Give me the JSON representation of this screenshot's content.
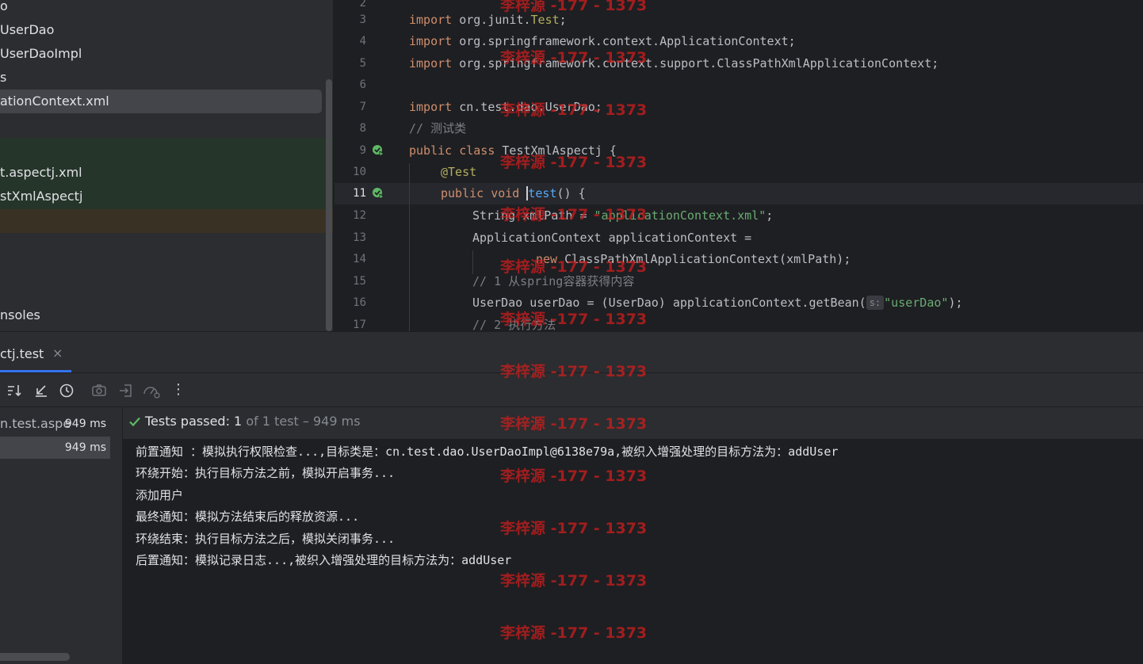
{
  "project_tree": {
    "items": [
      {
        "label": "o"
      },
      {
        "label": "UserDao"
      },
      {
        "label": "UserDaoImpl"
      },
      {
        "label": "s"
      },
      {
        "label": "ationContext.xml"
      },
      {
        "label": "t.aspectj.xml"
      },
      {
        "label": "stXmlAspectj"
      },
      {
        "label": "nsoles"
      }
    ]
  },
  "editor": {
    "lines": [
      {
        "num": "2"
      },
      {
        "num": "3"
      },
      {
        "num": "4"
      },
      {
        "num": "5"
      },
      {
        "num": "6"
      },
      {
        "num": "7"
      },
      {
        "num": "8"
      },
      {
        "num": "9"
      },
      {
        "num": "10"
      },
      {
        "num": "11"
      },
      {
        "num": "12"
      },
      {
        "num": "13"
      },
      {
        "num": "14"
      },
      {
        "num": "15"
      },
      {
        "num": "16"
      },
      {
        "num": "17"
      }
    ],
    "code": {
      "l3_kw": "import",
      "l3_rest": " org.junit.",
      "l3_test": "Test",
      "l3_end": ";",
      "l4_kw": "import",
      "l4_rest": " org.springframework.context.ApplicationContext;",
      "l5_kw": "import",
      "l5_rest": " org.springframework.context.support.ClassPathXmlApplicationContext;",
      "l7_kw": "import",
      "l7_rest": " cn.test.dao.UserDao;",
      "l8": "// 测试类",
      "l9_kw": "public class",
      "l9_rest": " TestXmlAspectj {",
      "l10": "@Test",
      "l11_kw": "public void",
      "l11_sp": " ",
      "l11_fn": "test",
      "l11_rest": "() {",
      "l12_a": "String xmlPath = ",
      "l12_str": "\"applicationContext.xml\"",
      "l12_end": ";",
      "l13": "ApplicationContext applicationContext =",
      "l14_kw": "new",
      "l14_rest": " ClassPathXmlApplicationContext(xmlPath);",
      "l15": "// 1 从spring容器获得内容",
      "l16_a": "UserDao userDao = (UserDao) applicationContext.getBean(",
      "l16_hint": "s:",
      "l16_str": "\"userDao\"",
      "l16_end": ");",
      "l17": "// 2 执行方法"
    }
  },
  "run_panel": {
    "tab_label": "ctj.test",
    "close_glyph": "×",
    "toolbar_icons": [
      "sort-icon",
      "collapse-icon",
      "history-icon",
      "screenshot-icon",
      "import-icon",
      "coverage-icon",
      "more-icon"
    ],
    "more_glyph": "⋮"
  },
  "test_tree": {
    "rows": [
      {
        "label": "n.test.aspe",
        "time": "949 ms"
      },
      {
        "label": "",
        "time": "949 ms"
      }
    ]
  },
  "status": {
    "label": "Tests passed: ",
    "count": "1",
    "detail": " of 1 test – 949 ms"
  },
  "console": {
    "lines": [
      "前置通知 ：模拟执行权限检查...,目标类是：cn.test.dao.UserDaoImpl@6138e79a,被织入增强处理的目标方法为：addUser",
      "环绕开始：执行目标方法之前，模拟开启事务...",
      "添加用户",
      "最终通知：模拟方法结束后的释放资源...",
      "环绕结束：执行目标方法之后，模拟关闭事务...",
      "后置通知：模拟记录日志...,被织入增强处理的目标方法为：addUser"
    ]
  },
  "watermark": {
    "text": "李梓源 -177 - 1373"
  },
  "colors": {
    "accent": "#3574f0",
    "pass_green": "#5fb865",
    "watermark": "#c81e1e"
  }
}
